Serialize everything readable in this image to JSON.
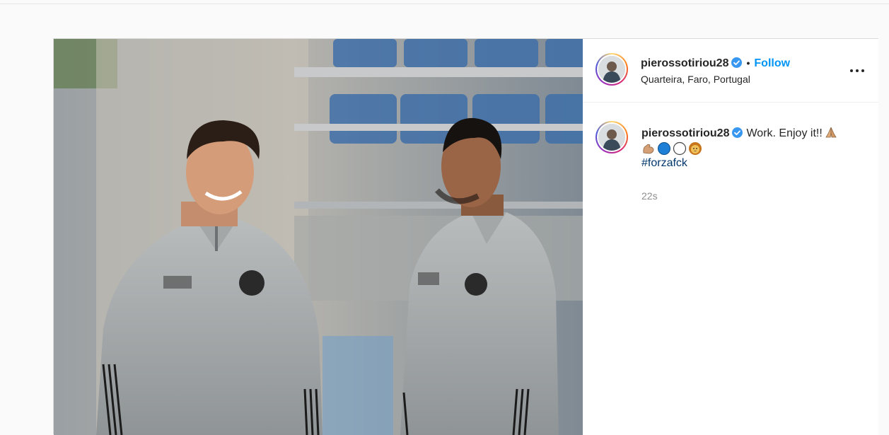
{
  "post": {
    "username": "pierossotiriou28",
    "follow_label": "Follow",
    "separator": "•",
    "location": "Quarteira, Faro, Portugal",
    "caption": {
      "text": "Work. Enjoy it!!",
      "emojis": [
        "folded-hands-icon",
        "flexed-biceps-icon",
        "blue-circle-icon",
        "white-circle-icon",
        "lion-face-icon"
      ],
      "hashtag": "#forzafck",
      "timestamp": "22s"
    },
    "media": {
      "description_icon": "post-photo"
    }
  },
  "colors": {
    "accent": "#0095f6",
    "hashtag": "#00376b",
    "verified": "#3897f0",
    "muted": "#8e8e8e"
  }
}
